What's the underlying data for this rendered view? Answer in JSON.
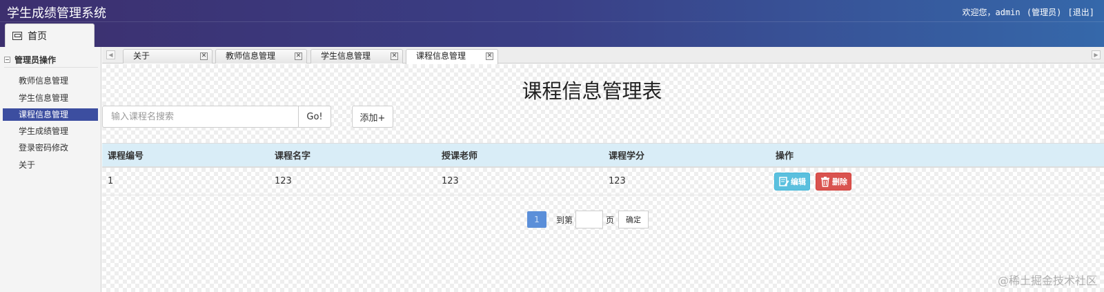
{
  "header": {
    "app_title": "学生成绩管理系统",
    "welcome": "欢迎您，admin",
    "role": "(管理员)",
    "logout": "[退出]",
    "home_tab": "首页",
    "gradient_colors": [
      "#3c2f6e",
      "#3568aa"
    ]
  },
  "sidebar": {
    "section_title": "管理员操作",
    "items": [
      {
        "label": "教师信息管理",
        "active": false
      },
      {
        "label": "学生信息管理",
        "active": false
      },
      {
        "label": "课程信息管理",
        "active": true
      },
      {
        "label": "学生成绩管理",
        "active": false
      },
      {
        "label": "登录密码修改",
        "active": false
      },
      {
        "label": "关于",
        "active": false
      }
    ],
    "active_color": "#3c4ea0"
  },
  "tabs": [
    {
      "label": "关于",
      "active": false
    },
    {
      "label": "教师信息管理",
      "active": false
    },
    {
      "label": "学生信息管理",
      "active": false
    },
    {
      "label": "课程信息管理",
      "active": true
    }
  ],
  "tab_close_symbol": "✕",
  "main": {
    "title": "课程信息管理表",
    "search_placeholder": "输入课程名搜索",
    "go_label": "Go!",
    "add_label": "添加+",
    "table": {
      "columns": [
        "课程编号",
        "课程名字",
        "授课老师",
        "课程学分",
        "操作"
      ],
      "rows": [
        [
          "1",
          "123",
          "123",
          "123"
        ]
      ],
      "edit_label": "编辑",
      "delete_label": "删除",
      "header_bg": "#d9edf7"
    },
    "pagination": {
      "current_page": "1",
      "goto_label": "到第",
      "page_suffix": "页",
      "confirm_label": "确定"
    }
  },
  "watermark": "@稀土掘金技术社区"
}
